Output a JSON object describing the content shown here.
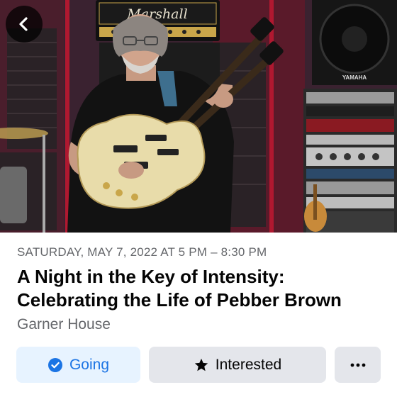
{
  "event": {
    "date_line": "SATURDAY, MAY 7, 2022 AT 5 PM – 8:30 PM",
    "title": "A Night in the Key of Intensity: Celebrating the Life of Pebber Brown",
    "venue": "Garner House"
  },
  "hero": {
    "amp_brand": "Marshall",
    "speaker_brand": "YAMAHA"
  },
  "actions": {
    "going_label": "Going",
    "interested_label": "Interested",
    "more_icon": "more-horizontal-icon"
  },
  "nav": {
    "back_icon": "chevron-left-icon"
  },
  "colors": {
    "going_bg": "#e7f3ff",
    "going_text": "#1b74e4",
    "button_bg": "#e4e6eb",
    "secondary_text": "#65676b",
    "primary_text": "#050505"
  }
}
